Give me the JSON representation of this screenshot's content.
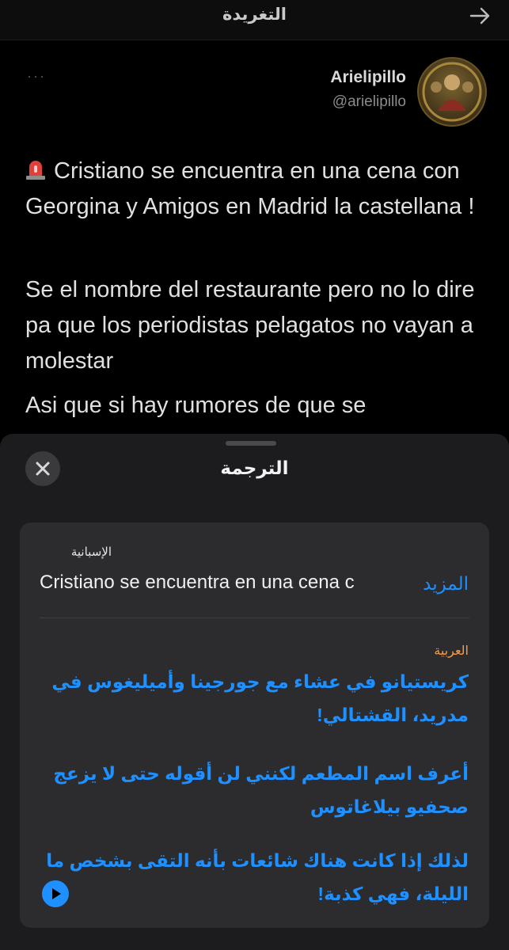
{
  "header": {
    "title": "التغريدة",
    "back_icon": "arrow-right-icon"
  },
  "tweet": {
    "display_name": "Arielipillo",
    "handle": "@arielipillo",
    "more_label": "···",
    "paragraphs": [
      "Cristiano se encuentra en una cena con Georgina y Amigos en Madrid la castellana !",
      "Se el nombre del restaurante pero no lo dire pa que los periodistas pelagatos no vayan a molestar",
      "Asi que si hay rumores de que se"
    ],
    "emoji_icon": "siren-icon"
  },
  "translation_sheet": {
    "title": "الترجمة",
    "close_icon": "close-icon",
    "source_language": "الإسبانية",
    "source_text": "Cristiano se encuentra en una cena c",
    "more_label": "المزيد",
    "target_language": "العربية",
    "target_paragraphs": [
      "كريستيانو في عشاء مع جورجينا وأميليغوس في مدريد، القشتالي!",
      "أعرف اسم المطعم لكنني لن أقوله حتى لا يزعج صحفيو بيلاغاتوس",
      "لذلك إذا كانت هناك شائعات بأنه التقى بشخص ما الليلة، فهي كذبة!"
    ],
    "play_icon": "play-icon"
  },
  "colors": {
    "accent": "#1e90ff",
    "target_label": "#ff9a3c",
    "sheet_bg": "#1c1c1e",
    "card_bg": "#2c2c2e"
  }
}
